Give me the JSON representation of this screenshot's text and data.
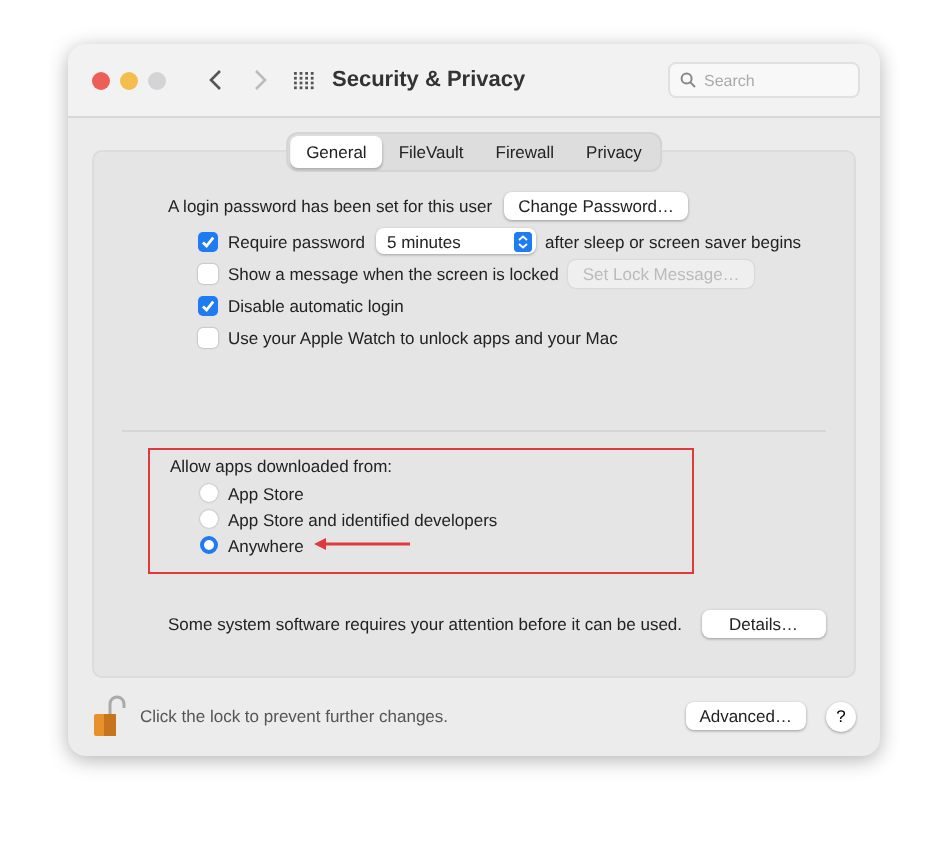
{
  "window": {
    "title": "Security & Privacy"
  },
  "search": {
    "placeholder": "Search"
  },
  "tabs": [
    {
      "label": "General",
      "selected": true
    },
    {
      "label": "FileVault",
      "selected": false
    },
    {
      "label": "Firewall",
      "selected": false
    },
    {
      "label": "Privacy",
      "selected": false
    }
  ],
  "login": {
    "text": "A login password has been set for this user",
    "button": "Change Password…"
  },
  "options": [
    {
      "kind": "select",
      "checked": true,
      "label": "Require password",
      "value": "5 minutes",
      "suffix": "after sleep or screen saver begins"
    },
    {
      "kind": "button",
      "checked": false,
      "label": "Show a message when the screen is locked",
      "button": "Set Lock Message…",
      "disabled": true
    },
    {
      "kind": "plain",
      "checked": true,
      "label": "Disable automatic login"
    },
    {
      "kind": "plain",
      "checked": false,
      "label": "Use your Apple Watch to unlock apps and your Mac"
    }
  ],
  "allow": {
    "heading": "Allow apps downloaded from:",
    "sources": [
      {
        "label": "App Store",
        "selected": false
      },
      {
        "label": "App Store and identified developers",
        "selected": false
      },
      {
        "label": "Anywhere",
        "selected": true
      }
    ]
  },
  "system": {
    "text": "Some system software requires your attention before it can be used.",
    "button": "Details…"
  },
  "footer": {
    "lock_text": "Click the lock to prevent further changes.",
    "advanced": "Advanced…",
    "help": "?"
  }
}
